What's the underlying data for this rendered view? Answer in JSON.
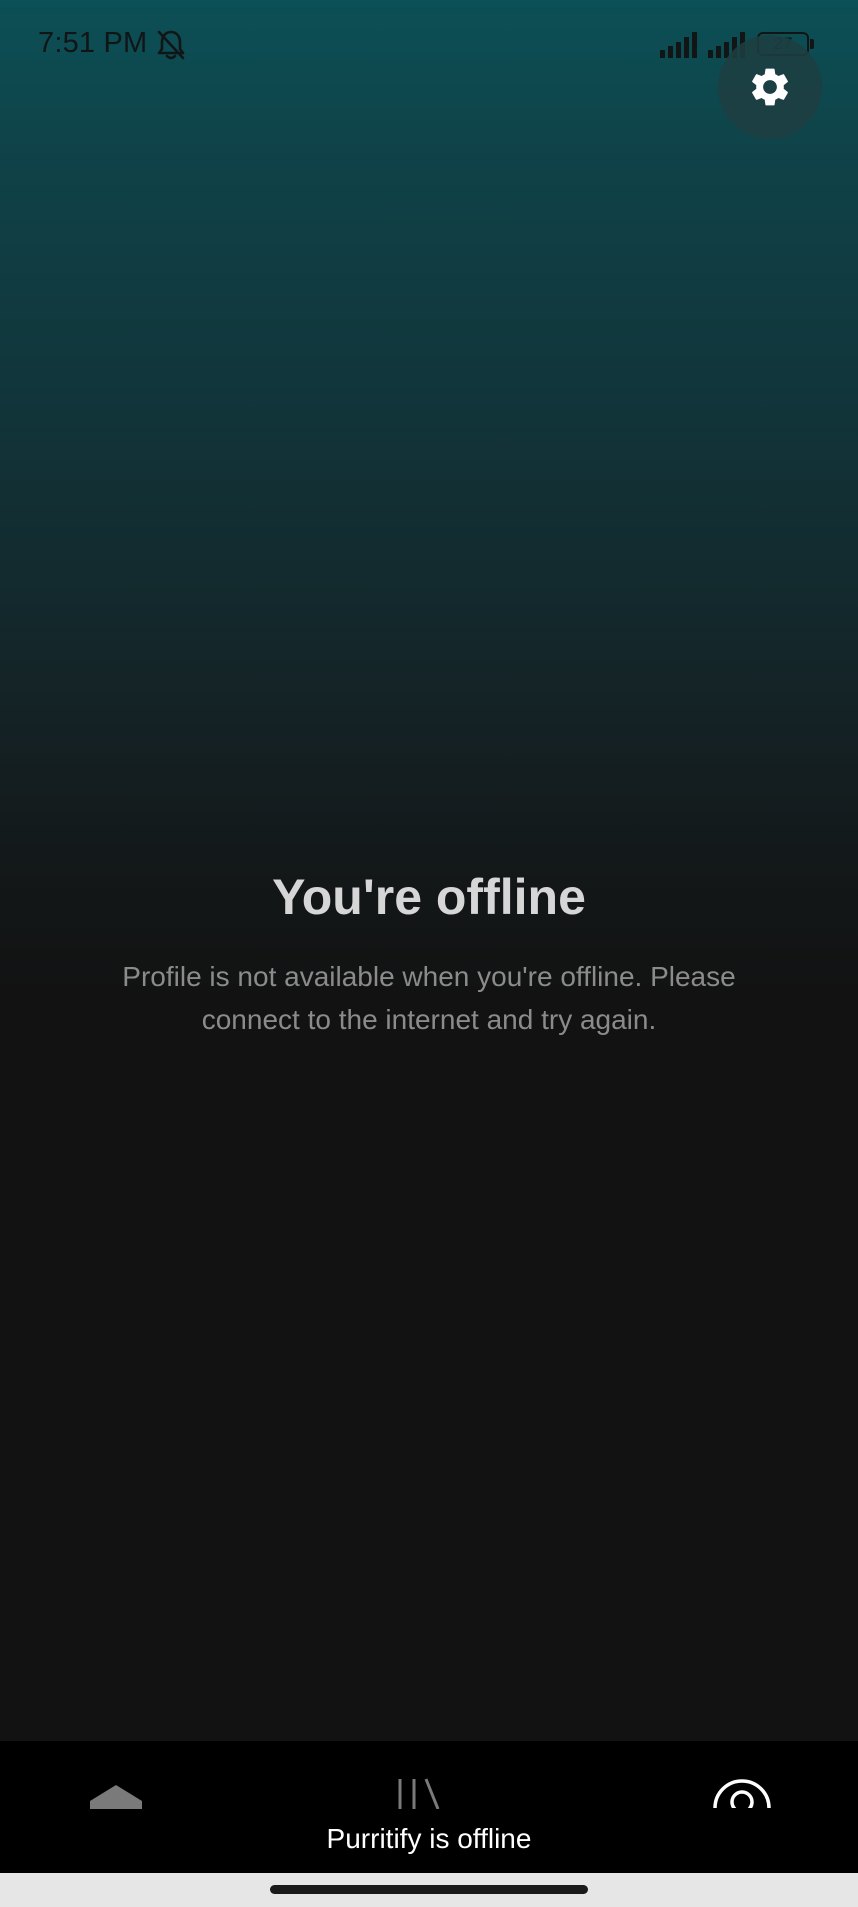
{
  "status_bar": {
    "time": "7:51 PM",
    "battery_level": "27",
    "icons": [
      "bell-off-icon",
      "signal-icon",
      "signal-icon",
      "battery-icon"
    ]
  },
  "header": {
    "settings_icon": "gear-icon"
  },
  "offline": {
    "title": "You're offline",
    "message": "Profile is not available when you're offline. Please connect to the internet and try again."
  },
  "bottom_nav": {
    "items": [
      {
        "icon": "home-icon"
      },
      {
        "icon": "library-icon"
      },
      {
        "icon": "profile-icon"
      }
    ],
    "banner": "Purritify is offline"
  },
  "colors": {
    "gradient_top": "#0b5056",
    "background": "#121212",
    "title_text": "#d6d6d6",
    "body_text": "#8b8b8b",
    "nav_background": "#000000"
  }
}
